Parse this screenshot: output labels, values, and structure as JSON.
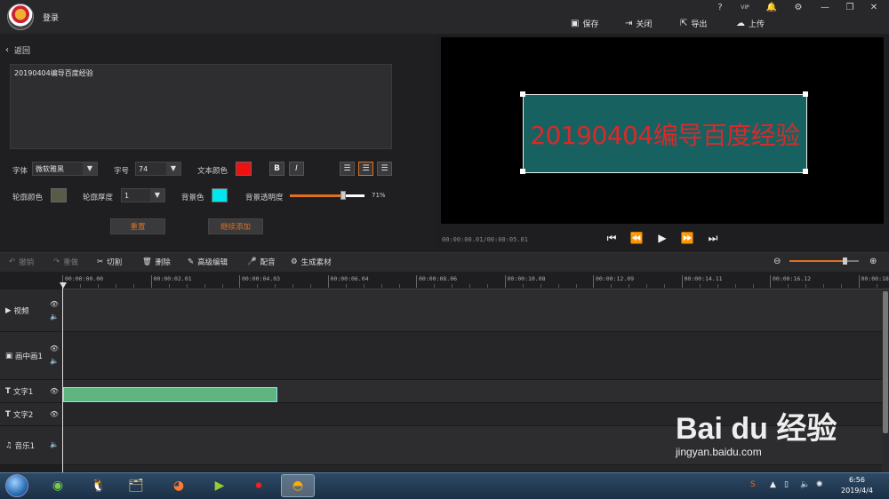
{
  "topbar": {
    "login": "登录",
    "window_buttons": [
      "?",
      "VIP",
      "🔔",
      "⚙",
      "—",
      "❐",
      "✕"
    ],
    "actions": [
      {
        "label": "保存",
        "icon": "save-icon"
      },
      {
        "label": "关闭",
        "icon": "exit-icon"
      },
      {
        "label": "导出",
        "icon": "export-icon"
      },
      {
        "label": "上传",
        "icon": "upload-icon"
      }
    ]
  },
  "editor": {
    "back_label": "返回",
    "text_value": "20190404编导百度经验",
    "font_label": "字体",
    "font_value": "微软雅黑",
    "size_label": "字号",
    "size_value": "74",
    "text_color_label": "文本颜色",
    "text_color": "#ee1111",
    "bold_label": "B",
    "italic_label": "I",
    "outline_color_label": "轮廓颜色",
    "outline_color": "#5a5a48",
    "outline_width_label": "轮廓厚度",
    "outline_width_value": "1",
    "bg_color_label": "背景色",
    "bg_color": "#00e5ee",
    "bg_opacity_label": "背景透明度",
    "bg_opacity_value": "71%",
    "bg_opacity": 0.71,
    "reset_label": "重置",
    "continue_label": "继续添加"
  },
  "preview": {
    "caption": "20190404编导百度经验",
    "time": "00:00:00.01/00:00:05.01"
  },
  "timeline_toolbar": {
    "undo": "撤销",
    "redo": "重做",
    "cut": "切割",
    "delete": "删除",
    "advanced_edit": "高级编辑",
    "dub": "配音",
    "generate": "生成素材",
    "zoom_level": 0.8
  },
  "ruler_ticks": [
    "00:00:00.00",
    "00:00:02.01",
    "00:00:04.03",
    "00:00:06.04",
    "00:00:08.06",
    "00:00:10.08",
    "00:00:12.09",
    "00:00:14.11",
    "00:00:16.12",
    "00:00:18."
  ],
  "tracks": [
    {
      "label": "视频",
      "icon": "film-icon"
    },
    {
      "label": "画中画1",
      "icon": "pip-icon"
    },
    {
      "label": "文字1",
      "icon": "text-icon"
    },
    {
      "label": "文字2",
      "icon": "text-icon"
    },
    {
      "label": "音乐1",
      "icon": "music-icon"
    }
  ],
  "taskbar": {
    "time": "6:56",
    "date": "2019/4/4"
  },
  "watermark": {
    "logo": "Bai du 经验",
    "url": "jingyan.baidu.com"
  },
  "colors": {
    "accent": "#e07020",
    "caption_bg": "#176161",
    "caption_text": "#d82a2a",
    "clip": "#5fb580"
  }
}
